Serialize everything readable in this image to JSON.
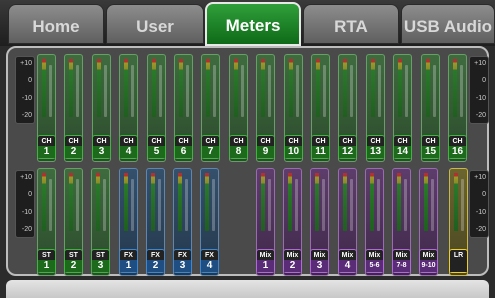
{
  "tabs": [
    {
      "label": "Home",
      "active": false
    },
    {
      "label": "User",
      "active": false
    },
    {
      "label": "Meters",
      "active": true
    },
    {
      "label": "RTA",
      "active": false
    },
    {
      "label": "USB Audio",
      "active": false
    }
  ],
  "scale_labels": [
    "+10",
    "0",
    "-10",
    "-20"
  ],
  "colors": {
    "green": "#1d6a1d",
    "blue": "#1f4f82",
    "purple": "#5a2c78",
    "yellow": "#f0d020",
    "active_tab": "#1f8a2a"
  },
  "rows": [
    {
      "strips": [
        {
          "top": "CH",
          "num": "1",
          "type": "channel",
          "color": "green"
        },
        {
          "top": "CH",
          "num": "2",
          "type": "channel",
          "color": "green"
        },
        {
          "top": "CH",
          "num": "3",
          "type": "channel",
          "color": "green"
        },
        {
          "top": "CH",
          "num": "4",
          "type": "channel",
          "color": "green"
        },
        {
          "top": "CH",
          "num": "5",
          "type": "channel",
          "color": "green"
        },
        {
          "top": "CH",
          "num": "6",
          "type": "channel",
          "color": "green"
        },
        {
          "top": "CH",
          "num": "7",
          "type": "channel",
          "color": "green"
        },
        {
          "top": "CH",
          "num": "8",
          "type": "channel",
          "color": "green"
        },
        {
          "top": "CH",
          "num": "9",
          "type": "channel",
          "color": "green"
        },
        {
          "top": "CH",
          "num": "10",
          "type": "channel",
          "color": "green"
        },
        {
          "top": "CH",
          "num": "11",
          "type": "channel",
          "color": "green"
        },
        {
          "top": "CH",
          "num": "12",
          "type": "channel",
          "color": "green"
        },
        {
          "top": "CH",
          "num": "13",
          "type": "channel",
          "color": "green"
        },
        {
          "top": "CH",
          "num": "14",
          "type": "channel",
          "color": "green"
        },
        {
          "top": "CH",
          "num": "15",
          "type": "channel",
          "color": "green"
        },
        {
          "top": "CH",
          "num": "16",
          "type": "channel",
          "color": "green"
        }
      ]
    },
    {
      "strips": [
        {
          "top": "ST",
          "num": "1",
          "type": "stereo",
          "color": "green"
        },
        {
          "top": "ST",
          "num": "2",
          "type": "stereo",
          "color": "green"
        },
        {
          "top": "ST",
          "num": "3",
          "type": "stereo",
          "color": "green"
        },
        {
          "top": "FX",
          "num": "1",
          "type": "fx",
          "color": "blue"
        },
        {
          "top": "FX",
          "num": "2",
          "type": "fx",
          "color": "blue"
        },
        {
          "top": "FX",
          "num": "3",
          "type": "fx",
          "color": "blue"
        },
        {
          "top": "FX",
          "num": "4",
          "type": "fx",
          "color": "blue"
        },
        {
          "top": "Mix",
          "num": "1",
          "type": "mix",
          "color": "purple"
        },
        {
          "top": "Mix",
          "num": "2",
          "type": "mix",
          "color": "purple"
        },
        {
          "top": "Mix",
          "num": "3",
          "type": "mix",
          "color": "purple"
        },
        {
          "top": "Mix",
          "num": "4",
          "type": "mix",
          "color": "purple"
        },
        {
          "top": "Mix",
          "num": "5-6",
          "type": "mix",
          "color": "purple"
        },
        {
          "top": "Mix",
          "num": "7-8",
          "type": "mix",
          "color": "purple"
        },
        {
          "top": "Mix",
          "num": "9-10",
          "type": "mix",
          "color": "purple"
        },
        {
          "top": "LR",
          "num": "",
          "type": "main",
          "color": "yellow"
        }
      ]
    }
  ]
}
